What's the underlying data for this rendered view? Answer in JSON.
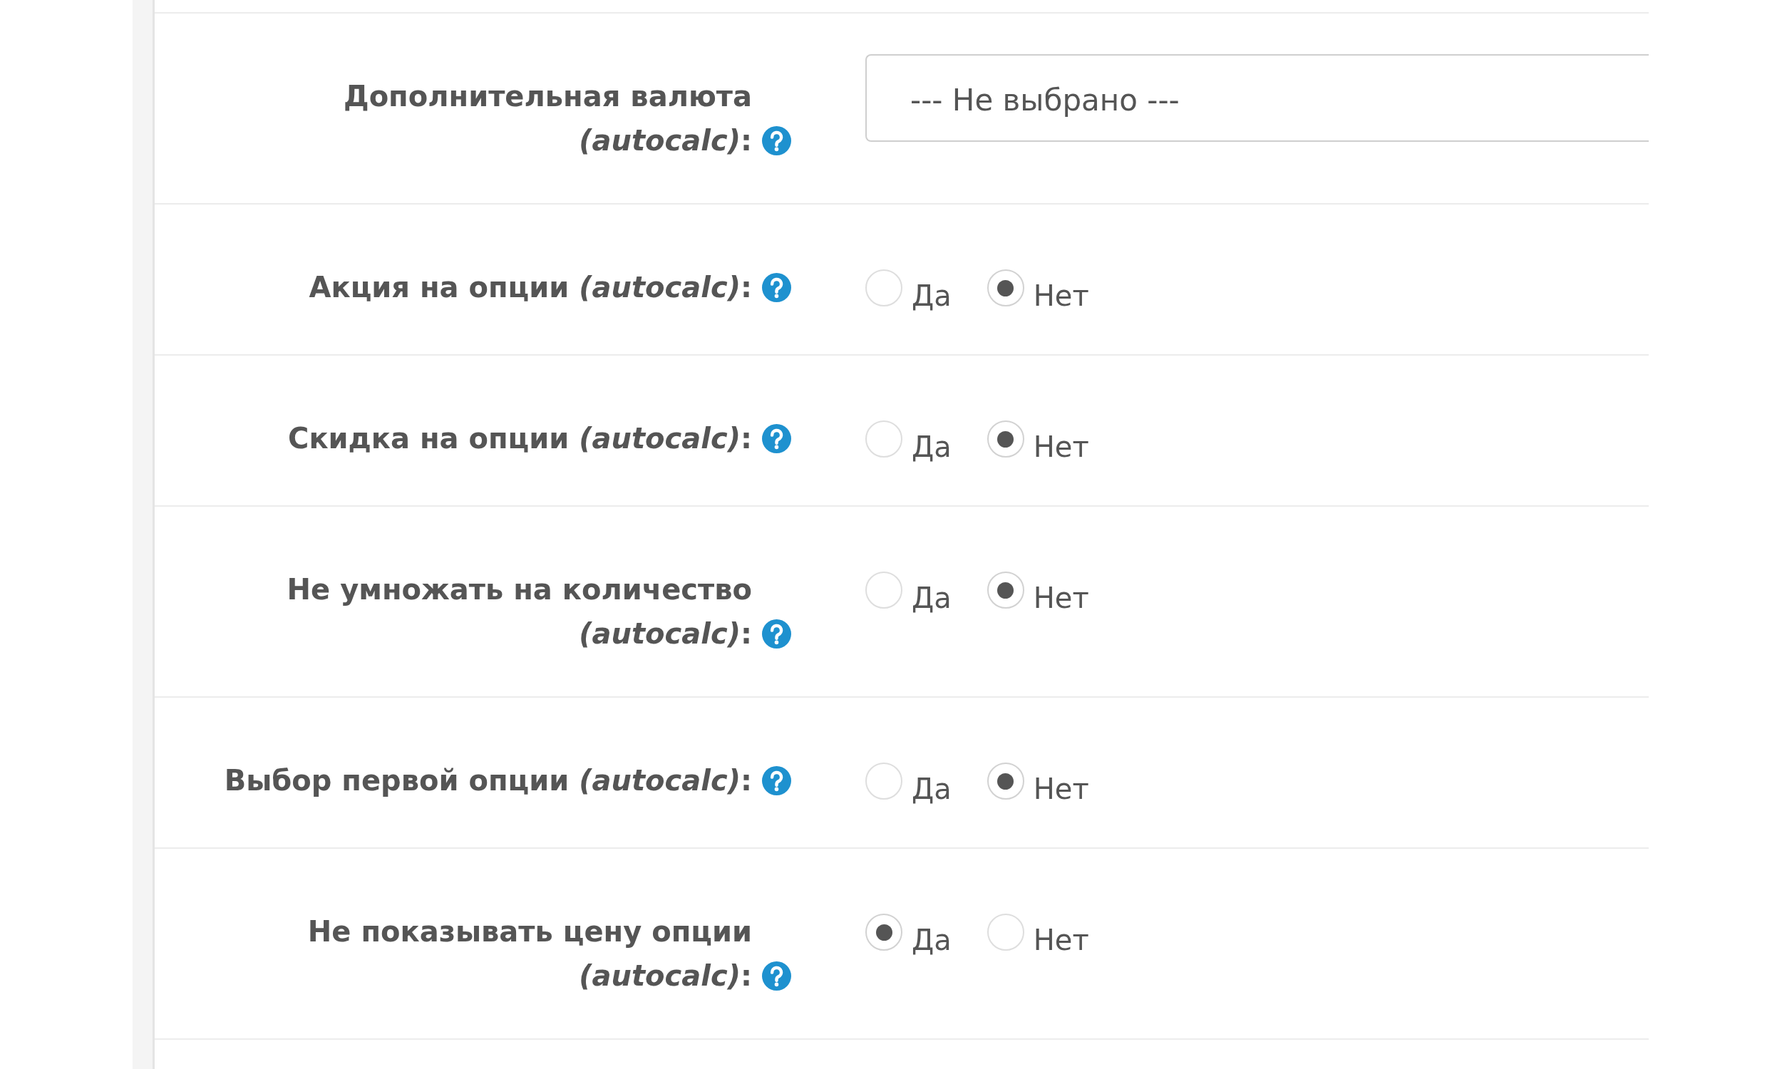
{
  "fields": [
    {
      "kind": "select",
      "label": "Дополнительная валюта *(autocalc)*:",
      "value": "--- Не выбрано ---"
    },
    {
      "kind": "radio",
      "label": "Акция на опции *(autocalc)*:",
      "options": [
        {
          "label": "Да",
          "selected": false
        },
        {
          "label": "Нет",
          "selected": true
        }
      ]
    },
    {
      "kind": "radio",
      "label": "Скидка на опции *(autocalc)*:",
      "options": [
        {
          "label": "Да",
          "selected": false
        },
        {
          "label": "Нет",
          "selected": true
        }
      ]
    },
    {
      "kind": "radio",
      "label": "Не умножать на количество *(autocalc)*:",
      "options": [
        {
          "label": "Да",
          "selected": false
        },
        {
          "label": "Нет",
          "selected": true
        }
      ]
    },
    {
      "kind": "radio",
      "label": "Выбор первой опции *(autocalc)*:",
      "options": [
        {
          "label": "Да",
          "selected": false
        },
        {
          "label": "Нет",
          "selected": true
        }
      ]
    },
    {
      "kind": "radio",
      "label": "Не показывать цену опции *(autocalc)*:",
      "options": [
        {
          "label": "Да",
          "selected": true
        },
        {
          "label": "Нет",
          "selected": false
        }
      ]
    }
  ]
}
